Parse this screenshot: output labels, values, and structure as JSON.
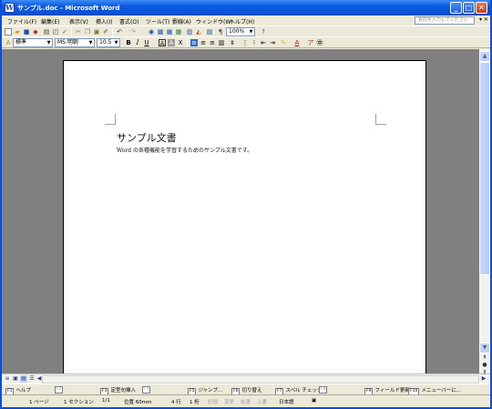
{
  "window": {
    "title": "サンプル.doc - Microsoft Word",
    "app_icon": "W",
    "minimize": "_",
    "maximize": "□",
    "close": "✕"
  },
  "menu": {
    "items": [
      "ファイル(F)",
      "編集(E)",
      "表示(V)",
      "挿入(I)",
      "書式(O)",
      "ツール(T)",
      "罫線(A)",
      "ウィンドウ(W)",
      "ヘルプ(H)"
    ],
    "help_placeholder": "質問を入力してください",
    "close_doc": "▾ ✕"
  },
  "toolbar_standard": {
    "zoom": "100%",
    "icons": [
      "new-icon",
      "open-icon",
      "save-icon",
      "permission-icon",
      "print-icon",
      "print-preview-icon",
      "spelling-icon",
      "cut-icon",
      "copy-icon",
      "paste-icon",
      "format-painter-icon",
      "undo-icon",
      "redo-icon",
      "hyperlink-icon",
      "tables-borders-icon",
      "insert-table-icon",
      "insert-excel-icon",
      "columns-icon",
      "drawing-icon",
      "document-map-icon",
      "show-hide-icon",
      "help-icon"
    ]
  },
  "toolbar_formatting": {
    "style": "標準",
    "font": "MS 明朝",
    "size": "10.5",
    "bold": "B",
    "italic": "I",
    "underline": "U"
  },
  "document": {
    "title": "サンプル文書",
    "body": "Word の各種機能を学習するためのサンプル文書です。"
  },
  "function_keys": [
    {
      "num": "F1",
      "label": "ヘルプ",
      "enabled": true
    },
    {
      "num": "F2",
      "label": "",
      "enabled": false
    },
    {
      "num": "F3",
      "label": "定型句挿入",
      "enabled": true
    },
    {
      "num": "F4",
      "label": "",
      "enabled": false
    },
    {
      "num": "F5",
      "label": "ジャンプ...",
      "enabled": true
    },
    {
      "num": "F6",
      "label": "切り替え",
      "enabled": true
    },
    {
      "num": "F7",
      "label": "スペル チェック...",
      "enabled": true
    },
    {
      "num": "F8",
      "label": "",
      "enabled": false
    },
    {
      "num": "F9",
      "label": "フィールド更新",
      "enabled": true
    },
    {
      "num": "F10",
      "label": "メニューバーに...",
      "enabled": true
    }
  ],
  "status": {
    "page": "1 ページ",
    "section": "1 セクション",
    "page_of": "1/1",
    "position": "位置 60mm",
    "line": "4 行",
    "column": "1 桁",
    "rec": "記録",
    "trk": "変更",
    "ext": "拡張",
    "ovr": "上書",
    "language": "日本語"
  }
}
